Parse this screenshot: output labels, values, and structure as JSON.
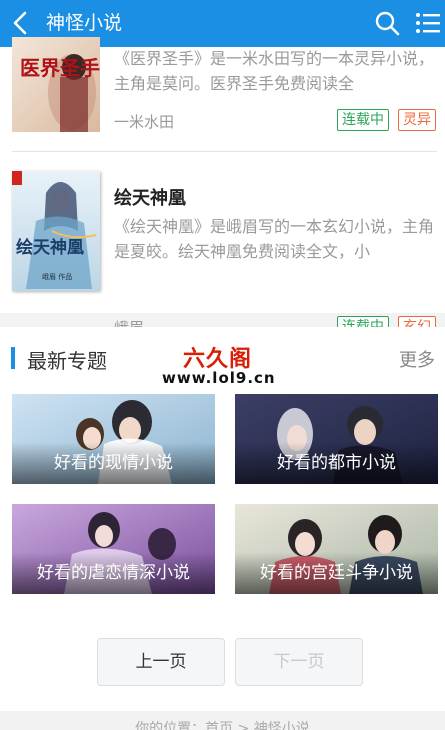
{
  "header": {
    "title": "神怪小说",
    "back_icon": "back-arrow-icon",
    "search_icon": "search-icon",
    "menu_icon": "list-menu-icon",
    "color": "#1a8fe3"
  },
  "books": [
    {
      "title": "医界圣手",
      "description": "《医界圣手》是一米水田写的一本灵异小说，主角是莫问。医界圣手免费阅读全",
      "author": "一米水田",
      "status": "连载中",
      "genre": "灵异",
      "cover_text": "医界圣手"
    },
    {
      "title": "绘天神凰",
      "description": "《绘天神凰》是峨眉写的一本玄幻小说，主角是夏皎。绘天神凰免费阅读全文，小",
      "author": "峨眉",
      "status": "连载中",
      "genre": "玄幻",
      "cover_text": "绘天神凰",
      "cover_author": "峨眉 作品"
    }
  ],
  "topics": {
    "title": "最新专题",
    "more": "更多",
    "items": [
      {
        "label": "好看的现情小说"
      },
      {
        "label": "好看的都市小说"
      },
      {
        "label": "好看的虐恋情深小说"
      },
      {
        "label": "好看的宫廷斗争小说"
      }
    ]
  },
  "watermark": {
    "logo": "六久阁",
    "url": "www.lol9.cn"
  },
  "pager": {
    "prev": "上一页",
    "next": "下一页"
  },
  "breadcrumb": "你的位置：首页 > 神怪小说",
  "colors": {
    "status": "#2aa55a",
    "genre": "#ee6a3c",
    "watermark": "#d81e06"
  }
}
